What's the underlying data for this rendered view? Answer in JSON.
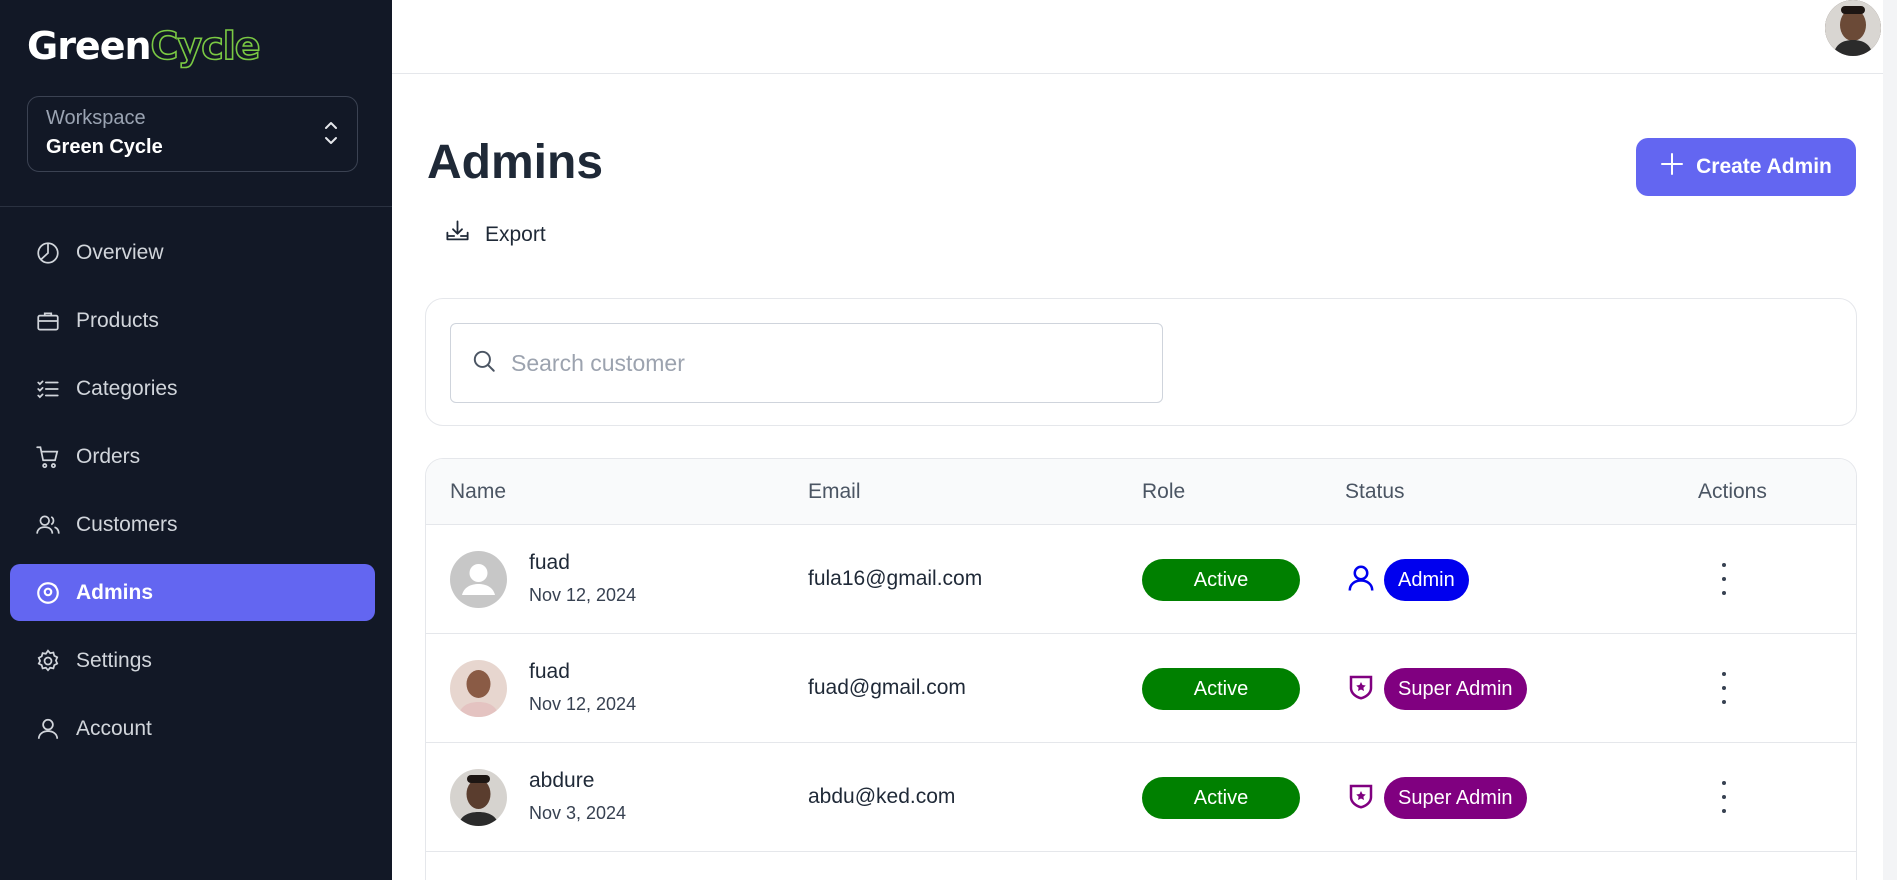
{
  "brand": {
    "part1": "Green",
    "part2": "Cycle"
  },
  "workspace": {
    "label": "Workspace",
    "value": "Green Cycle"
  },
  "nav": [
    {
      "label": "Overview",
      "icon": "pie-chart-icon"
    },
    {
      "label": "Products",
      "icon": "briefcase-icon"
    },
    {
      "label": "Categories",
      "icon": "list-checks-icon"
    },
    {
      "label": "Orders",
      "icon": "cart-icon"
    },
    {
      "label": "Customers",
      "icon": "users-icon"
    },
    {
      "label": "Admins",
      "icon": "user-gear-icon",
      "active": true
    },
    {
      "label": "Settings",
      "icon": "gear-icon"
    },
    {
      "label": "Account",
      "icon": "user-icon"
    }
  ],
  "page": {
    "title": "Admins",
    "create_label": "Create Admin",
    "export_label": "Export"
  },
  "search": {
    "placeholder": "Search customer"
  },
  "table": {
    "headers": {
      "name": "Name",
      "email": "Email",
      "role": "Role",
      "status": "Status",
      "actions": "Actions"
    },
    "rows": [
      {
        "name": "fuad",
        "date": "Nov 12, 2024",
        "email": "fula16@gmail.com",
        "role": "Active",
        "status": "Admin",
        "status_color": "#0000ee"
      },
      {
        "name": "fuad",
        "date": "Nov 12, 2024",
        "email": "fuad@gmail.com",
        "role": "Active",
        "status": "Super Admin",
        "status_color": "#800080"
      },
      {
        "name": "abdure",
        "date": "Nov 3, 2024",
        "email": "abdu@ked.com",
        "role": "Active",
        "status": "Super Admin",
        "status_color": "#800080"
      }
    ]
  },
  "colors": {
    "sidebar": "#121826",
    "accent": "#6366f1",
    "active_green": "#008000",
    "brand_green": "#7ac943"
  }
}
